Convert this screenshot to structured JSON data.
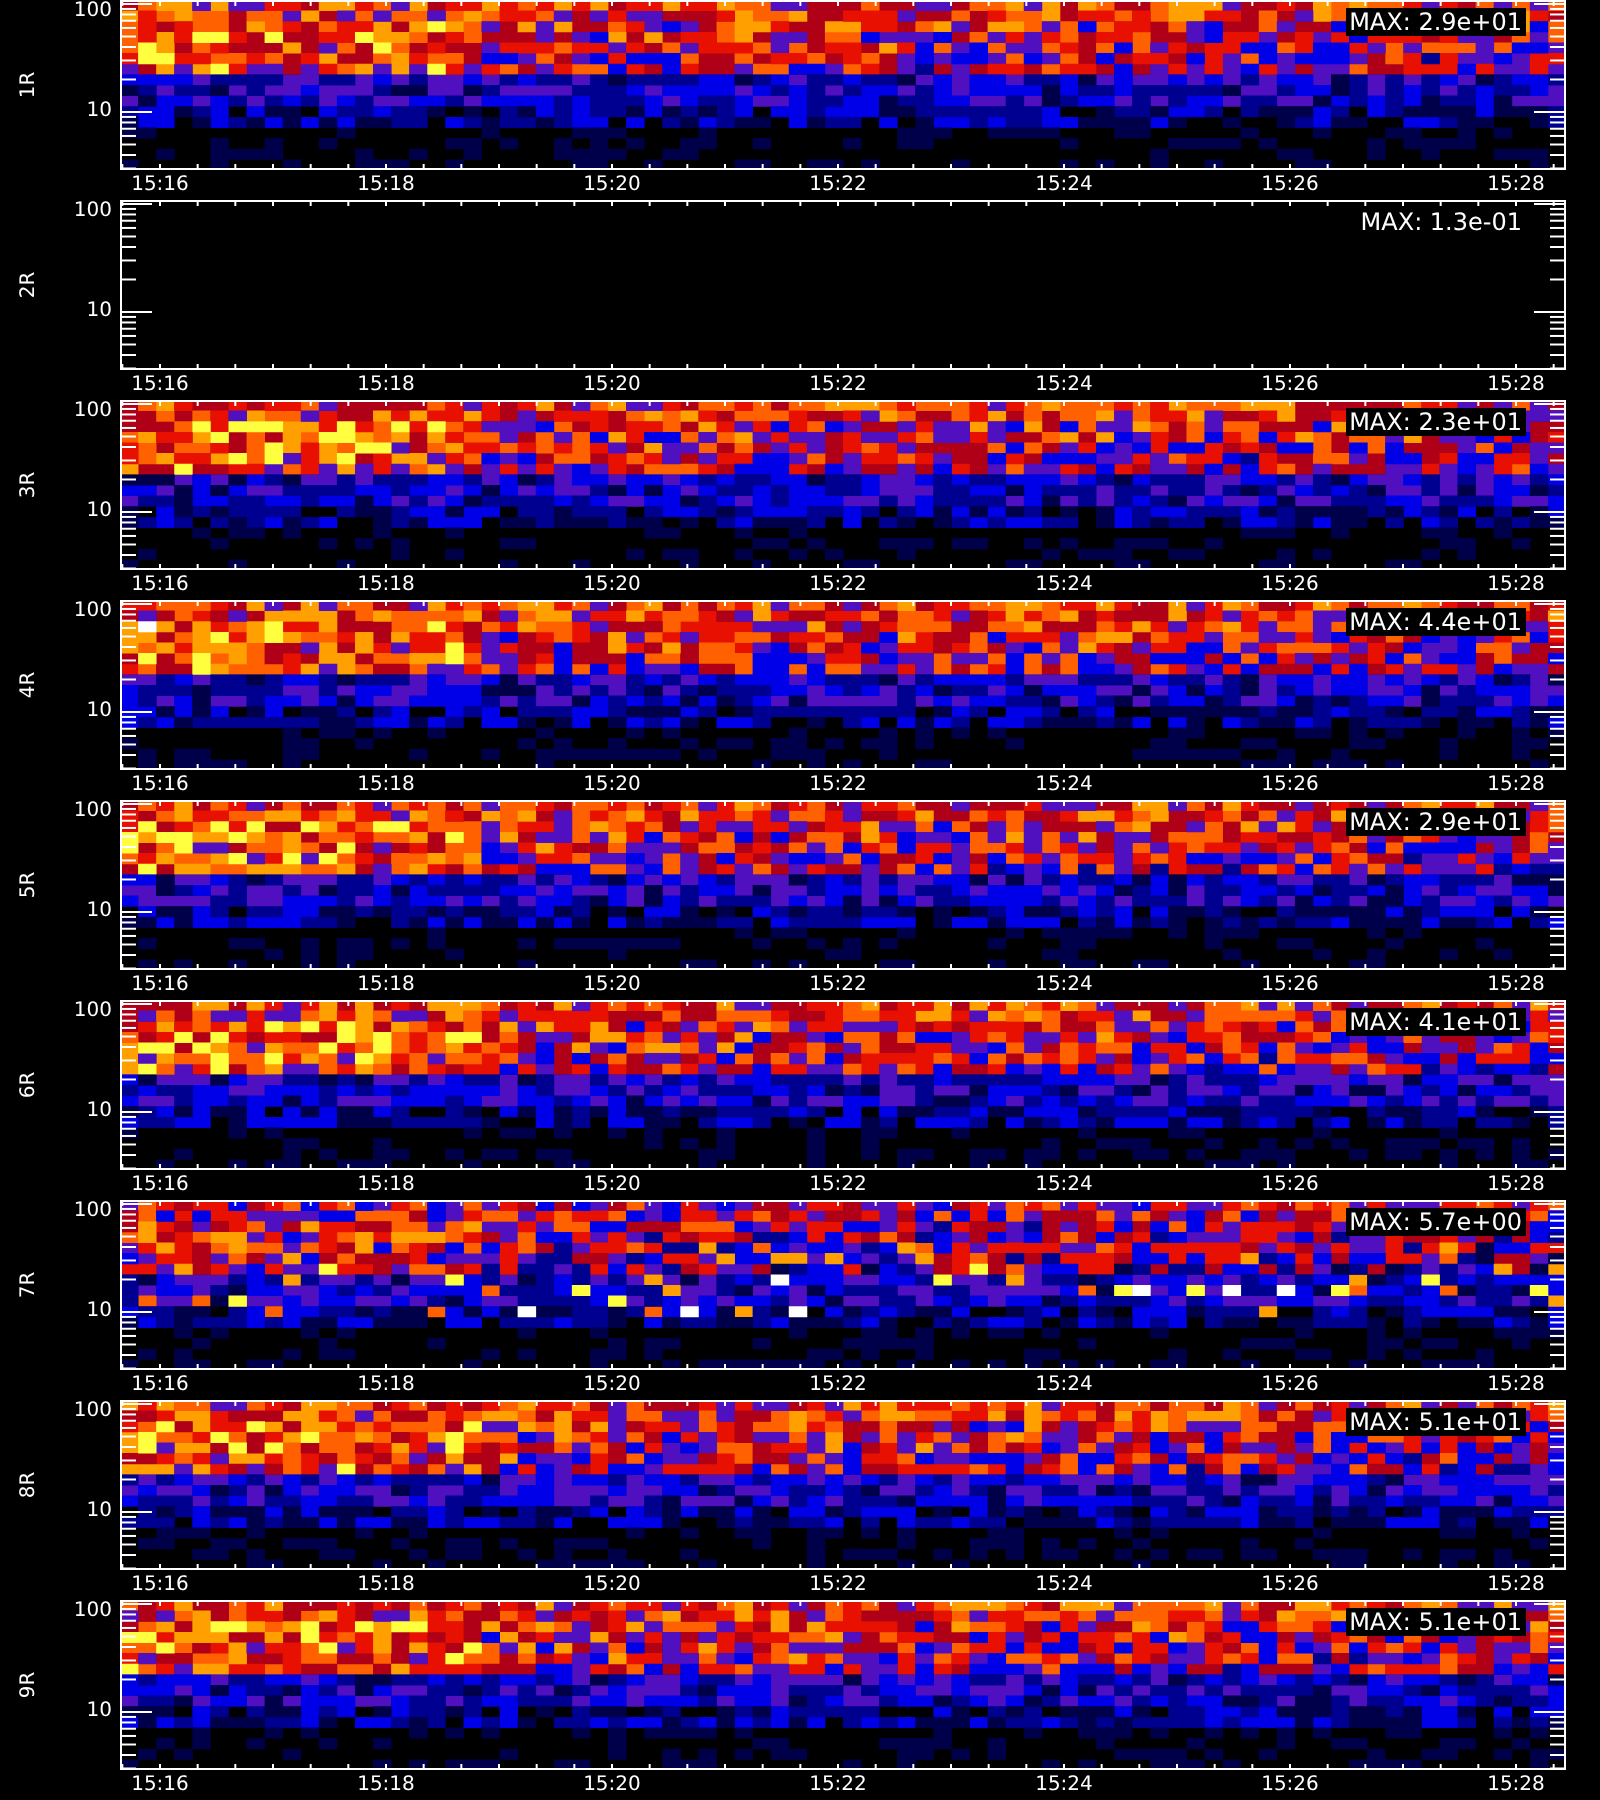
{
  "panels": [
    {
      "label": "1R",
      "kind": "spectrogram",
      "max": "MAX: 2.9e+01",
      "y_ticks": [
        "100",
        "10"
      ],
      "x_ticks": [
        "15:16",
        "15:18",
        "15:20",
        "15:22",
        "15:24",
        "15:26",
        "15:28"
      ]
    },
    {
      "label": "2R",
      "kind": "empty",
      "max": "MAX: 1.3e-01",
      "y_ticks": [
        "100",
        "10"
      ],
      "x_ticks": [
        "15:16",
        "15:18",
        "15:20",
        "15:22",
        "15:24",
        "15:26",
        "15:28"
      ]
    },
    {
      "label": "3R",
      "kind": "spectrogram",
      "max": "MAX: 2.3e+01",
      "y_ticks": [
        "100",
        "10"
      ],
      "x_ticks": [
        "15:16",
        "15:18",
        "15:20",
        "15:22",
        "15:24",
        "15:26",
        "15:28"
      ]
    },
    {
      "label": "4R",
      "kind": "spectrogram",
      "max": "MAX: 4.4e+01",
      "y_ticks": [
        "100",
        "10"
      ],
      "x_ticks": [
        "15:16",
        "15:18",
        "15:20",
        "15:22",
        "15:24",
        "15:26",
        "15:28"
      ]
    },
    {
      "label": "5R",
      "kind": "spectrogram",
      "max": "MAX: 2.9e+01",
      "y_ticks": [
        "100",
        "10"
      ],
      "x_ticks": [
        "15:16",
        "15:18",
        "15:20",
        "15:22",
        "15:24",
        "15:26",
        "15:28"
      ]
    },
    {
      "label": "6R",
      "kind": "spectrogram",
      "max": "MAX: 4.1e+01",
      "y_ticks": [
        "100",
        "10"
      ],
      "x_ticks": [
        "15:16",
        "15:18",
        "15:20",
        "15:22",
        "15:24",
        "15:26",
        "15:28"
      ]
    },
    {
      "label": "7R",
      "kind": "scattered",
      "max": "MAX: 5.7e+00",
      "y_ticks": [
        "100",
        "10"
      ],
      "x_ticks": [
        "15:16",
        "15:18",
        "15:20",
        "15:22",
        "15:24",
        "15:26",
        "15:28"
      ]
    },
    {
      "label": "8R",
      "kind": "spectrogram",
      "max": "MAX: 5.1e+01",
      "y_ticks": [
        "100",
        "10"
      ],
      "x_ticks": [
        "15:16",
        "15:18",
        "15:20",
        "15:22",
        "15:24",
        "15:26",
        "15:28"
      ]
    },
    {
      "label": "9R",
      "kind": "spectrogram",
      "max": "MAX: 5.1e+01",
      "y_ticks": [
        "100",
        "10"
      ],
      "x_ticks": [
        "15:16",
        "15:18",
        "15:20",
        "15:22",
        "15:24",
        "15:26",
        "15:28"
      ]
    }
  ]
}
